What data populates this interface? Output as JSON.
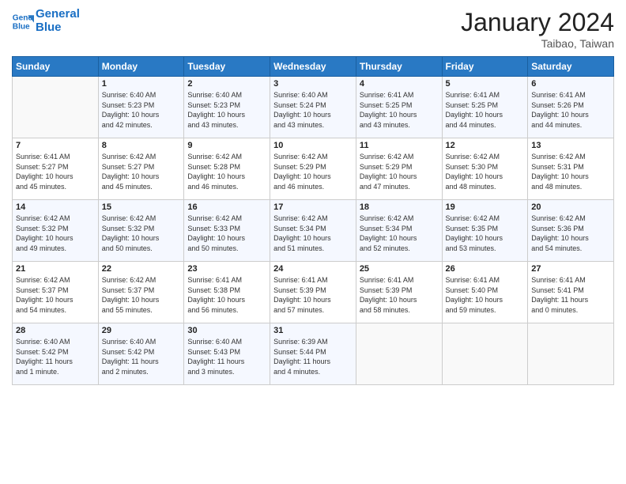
{
  "logo": {
    "line1": "General",
    "line2": "Blue"
  },
  "title": "January 2024",
  "location": "Taibao, Taiwan",
  "days_of_week": [
    "Sunday",
    "Monday",
    "Tuesday",
    "Wednesday",
    "Thursday",
    "Friday",
    "Saturday"
  ],
  "weeks": [
    [
      {
        "num": "",
        "info": ""
      },
      {
        "num": "1",
        "info": "Sunrise: 6:40 AM\nSunset: 5:23 PM\nDaylight: 10 hours\nand 42 minutes."
      },
      {
        "num": "2",
        "info": "Sunrise: 6:40 AM\nSunset: 5:23 PM\nDaylight: 10 hours\nand 43 minutes."
      },
      {
        "num": "3",
        "info": "Sunrise: 6:40 AM\nSunset: 5:24 PM\nDaylight: 10 hours\nand 43 minutes."
      },
      {
        "num": "4",
        "info": "Sunrise: 6:41 AM\nSunset: 5:25 PM\nDaylight: 10 hours\nand 43 minutes."
      },
      {
        "num": "5",
        "info": "Sunrise: 6:41 AM\nSunset: 5:25 PM\nDaylight: 10 hours\nand 44 minutes."
      },
      {
        "num": "6",
        "info": "Sunrise: 6:41 AM\nSunset: 5:26 PM\nDaylight: 10 hours\nand 44 minutes."
      }
    ],
    [
      {
        "num": "7",
        "info": "Sunrise: 6:41 AM\nSunset: 5:27 PM\nDaylight: 10 hours\nand 45 minutes."
      },
      {
        "num": "8",
        "info": "Sunrise: 6:42 AM\nSunset: 5:27 PM\nDaylight: 10 hours\nand 45 minutes."
      },
      {
        "num": "9",
        "info": "Sunrise: 6:42 AM\nSunset: 5:28 PM\nDaylight: 10 hours\nand 46 minutes."
      },
      {
        "num": "10",
        "info": "Sunrise: 6:42 AM\nSunset: 5:29 PM\nDaylight: 10 hours\nand 46 minutes."
      },
      {
        "num": "11",
        "info": "Sunrise: 6:42 AM\nSunset: 5:29 PM\nDaylight: 10 hours\nand 47 minutes."
      },
      {
        "num": "12",
        "info": "Sunrise: 6:42 AM\nSunset: 5:30 PM\nDaylight: 10 hours\nand 48 minutes."
      },
      {
        "num": "13",
        "info": "Sunrise: 6:42 AM\nSunset: 5:31 PM\nDaylight: 10 hours\nand 48 minutes."
      }
    ],
    [
      {
        "num": "14",
        "info": "Sunrise: 6:42 AM\nSunset: 5:32 PM\nDaylight: 10 hours\nand 49 minutes."
      },
      {
        "num": "15",
        "info": "Sunrise: 6:42 AM\nSunset: 5:32 PM\nDaylight: 10 hours\nand 50 minutes."
      },
      {
        "num": "16",
        "info": "Sunrise: 6:42 AM\nSunset: 5:33 PM\nDaylight: 10 hours\nand 50 minutes."
      },
      {
        "num": "17",
        "info": "Sunrise: 6:42 AM\nSunset: 5:34 PM\nDaylight: 10 hours\nand 51 minutes."
      },
      {
        "num": "18",
        "info": "Sunrise: 6:42 AM\nSunset: 5:34 PM\nDaylight: 10 hours\nand 52 minutes."
      },
      {
        "num": "19",
        "info": "Sunrise: 6:42 AM\nSunset: 5:35 PM\nDaylight: 10 hours\nand 53 minutes."
      },
      {
        "num": "20",
        "info": "Sunrise: 6:42 AM\nSunset: 5:36 PM\nDaylight: 10 hours\nand 54 minutes."
      }
    ],
    [
      {
        "num": "21",
        "info": "Sunrise: 6:42 AM\nSunset: 5:37 PM\nDaylight: 10 hours\nand 54 minutes."
      },
      {
        "num": "22",
        "info": "Sunrise: 6:42 AM\nSunset: 5:37 PM\nDaylight: 10 hours\nand 55 minutes."
      },
      {
        "num": "23",
        "info": "Sunrise: 6:41 AM\nSunset: 5:38 PM\nDaylight: 10 hours\nand 56 minutes."
      },
      {
        "num": "24",
        "info": "Sunrise: 6:41 AM\nSunset: 5:39 PM\nDaylight: 10 hours\nand 57 minutes."
      },
      {
        "num": "25",
        "info": "Sunrise: 6:41 AM\nSunset: 5:39 PM\nDaylight: 10 hours\nand 58 minutes."
      },
      {
        "num": "26",
        "info": "Sunrise: 6:41 AM\nSunset: 5:40 PM\nDaylight: 10 hours\nand 59 minutes."
      },
      {
        "num": "27",
        "info": "Sunrise: 6:41 AM\nSunset: 5:41 PM\nDaylight: 11 hours\nand 0 minutes."
      }
    ],
    [
      {
        "num": "28",
        "info": "Sunrise: 6:40 AM\nSunset: 5:42 PM\nDaylight: 11 hours\nand 1 minute."
      },
      {
        "num": "29",
        "info": "Sunrise: 6:40 AM\nSunset: 5:42 PM\nDaylight: 11 hours\nand 2 minutes."
      },
      {
        "num": "30",
        "info": "Sunrise: 6:40 AM\nSunset: 5:43 PM\nDaylight: 11 hours\nand 3 minutes."
      },
      {
        "num": "31",
        "info": "Sunrise: 6:39 AM\nSunset: 5:44 PM\nDaylight: 11 hours\nand 4 minutes."
      },
      {
        "num": "",
        "info": ""
      },
      {
        "num": "",
        "info": ""
      },
      {
        "num": "",
        "info": ""
      }
    ]
  ]
}
